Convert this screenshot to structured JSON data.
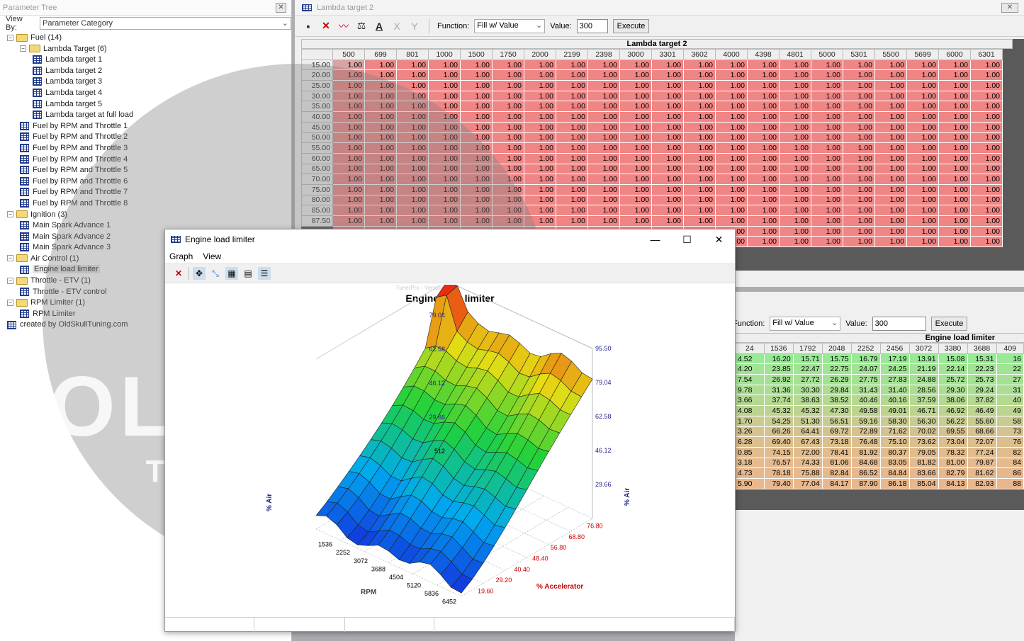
{
  "tree": {
    "title": "Parameter Tree",
    "view_by_label": "View By:",
    "view_by_value": "Parameter Category",
    "items": [
      {
        "indent": 0,
        "type": "folder",
        "label": "Fuel (14)",
        "exp": "−"
      },
      {
        "indent": 1,
        "type": "folder",
        "label": "Lambda Target (6)",
        "exp": "−"
      },
      {
        "indent": 2,
        "type": "table",
        "label": "Lambda target 1"
      },
      {
        "indent": 2,
        "type": "table",
        "label": "Lambda target 2"
      },
      {
        "indent": 2,
        "type": "table",
        "label": "Lambda target 3"
      },
      {
        "indent": 2,
        "type": "table",
        "label": "Lambda target 4"
      },
      {
        "indent": 2,
        "type": "table",
        "label": "Lambda target 5"
      },
      {
        "indent": 2,
        "type": "table",
        "label": "Lambda target at full load"
      },
      {
        "indent": 1,
        "type": "table",
        "label": "Fuel by RPM and Throttle 1"
      },
      {
        "indent": 1,
        "type": "table",
        "label": "Fuel by RPM and Throttle 2"
      },
      {
        "indent": 1,
        "type": "table",
        "label": "Fuel by RPM and Throttle 3"
      },
      {
        "indent": 1,
        "type": "table",
        "label": "Fuel by RPM and Throttle 4"
      },
      {
        "indent": 1,
        "type": "table",
        "label": "Fuel by RPM and Throttle 5"
      },
      {
        "indent": 1,
        "type": "table",
        "label": "Fuel by RPM and Throttle 6"
      },
      {
        "indent": 1,
        "type": "table",
        "label": "Fuel by RPM and Throttle 7"
      },
      {
        "indent": 1,
        "type": "table",
        "label": "Fuel by RPM and Throttle 8"
      },
      {
        "indent": 0,
        "type": "folder",
        "label": "Ignition (3)",
        "exp": "−"
      },
      {
        "indent": 1,
        "type": "table",
        "label": "Main Spark Advance 1"
      },
      {
        "indent": 1,
        "type": "table",
        "label": "Main Spark Advance 2"
      },
      {
        "indent": 1,
        "type": "table",
        "label": "Main Spark Advance 3"
      },
      {
        "indent": 0,
        "type": "folder",
        "label": "Air Control (1)",
        "exp": "−"
      },
      {
        "indent": 1,
        "type": "table",
        "label": "Engine load limiter",
        "selected": true
      },
      {
        "indent": 0,
        "type": "folder",
        "label": "Throttle - ETV (1)",
        "exp": "−"
      },
      {
        "indent": 1,
        "type": "table",
        "label": "Throttle - ETV control"
      },
      {
        "indent": 0,
        "type": "folder",
        "label": "RPM Limiter (1)",
        "exp": "−"
      },
      {
        "indent": 1,
        "type": "table",
        "label": "RPM Limiter"
      },
      {
        "indent": 0,
        "type": "table",
        "label": "created by OldSkullTuning.com"
      }
    ]
  },
  "lambda_window": {
    "title": "Lambda target 2",
    "function_label": "Function:",
    "function_value": "Fill w/ Value",
    "value_label": "Value:",
    "value": "300",
    "execute_label": "Execute",
    "table_caption": "Lambda target 2",
    "columns": [
      "500",
      "699",
      "801",
      "1000",
      "1500",
      "1750",
      "2000",
      "2199",
      "2398",
      "3000",
      "3301",
      "3602",
      "4000",
      "4398",
      "4801",
      "5000",
      "5301",
      "5500",
      "5699",
      "6000",
      "6301"
    ],
    "rows": [
      "15.00",
      "20.00",
      "25.00",
      "30.00",
      "35.00",
      "40.00",
      "45.00",
      "50.00",
      "55.00",
      "60.00",
      "65.00",
      "70.00",
      "75.00",
      "80.00",
      "85.00",
      "87.50",
      "",
      ""
    ],
    "cell_value": "1.00",
    "cell_color": "#f08585",
    "first_cell_color": "#d9a3a3"
  },
  "ell_window": {
    "function_label": "Function:",
    "function_value": "Fill w/ Value",
    "value_label": "Value:",
    "value": "300",
    "execute_label": "Execute",
    "table_caption": "Engine load limiter",
    "columns": [
      "24",
      "1536",
      "1792",
      "2048",
      "2252",
      "2456",
      "3072",
      "3380",
      "3688",
      "409"
    ],
    "rows": [
      [
        "4.52",
        "16.20",
        "15.71",
        "15.75",
        "16.79",
        "17.19",
        "13.91",
        "15.08",
        "15.31",
        "16"
      ],
      [
        "4.20",
        "23.85",
        "22.47",
        "22.75",
        "24.07",
        "24.25",
        "21.19",
        "22.14",
        "22.23",
        "22"
      ],
      [
        "7.54",
        "26.92",
        "27.72",
        "26.29",
        "27.75",
        "27.83",
        "24.88",
        "25.72",
        "25.73",
        "27"
      ],
      [
        "9.78",
        "31.36",
        "30.30",
        "29.84",
        "31.43",
        "31.40",
        "28.56",
        "29.30",
        "29.24",
        "31"
      ],
      [
        "3.66",
        "37.74",
        "38.63",
        "38.52",
        "40.46",
        "40.16",
        "37.59",
        "38.06",
        "37.82",
        "40"
      ],
      [
        "4.08",
        "45.32",
        "45.32",
        "47.30",
        "49.58",
        "49.01",
        "46.71",
        "46.92",
        "46.49",
        "49"
      ],
      [
        "1.70",
        "54.25",
        "51.30",
        "56.51",
        "59.16",
        "58.30",
        "56.30",
        "56.22",
        "55.60",
        "58"
      ],
      [
        "3.26",
        "66.26",
        "64.41",
        "69.72",
        "72.89",
        "71.62",
        "70.02",
        "69.55",
        "68.66",
        "73"
      ],
      [
        "6.28",
        "69.40",
        "67.43",
        "73.18",
        "76.48",
        "75.10",
        "73.62",
        "73.04",
        "72.07",
        "76"
      ],
      [
        "0.85",
        "74.15",
        "72.00",
        "78.41",
        "81.92",
        "80.37",
        "79.05",
        "78.32",
        "77.24",
        "82"
      ],
      [
        "3.18",
        "76.57",
        "74.33",
        "81.06",
        "84.68",
        "83.05",
        "81.82",
        "81.00",
        "79.87",
        "84"
      ],
      [
        "4.73",
        "78.18",
        "75.88",
        "82.84",
        "86.52",
        "84.84",
        "83.66",
        "82.79",
        "81.62",
        "86"
      ],
      [
        "5.90",
        "79.40",
        "77.04",
        "84.17",
        "87.90",
        "86.18",
        "85.04",
        "84.13",
        "82.93",
        "88"
      ]
    ]
  },
  "graph_window": {
    "title": "Engine load limiter",
    "menu": [
      "Graph",
      "View"
    ],
    "version_text": "TunerPro - Version 5.00",
    "chart_title": "Engine load limiter",
    "z_label": "% Air",
    "x_label": "RPM",
    "y_label": "% Accelerator",
    "z_ticks": [
      "95.50",
      "79.04",
      "62.58",
      "46.12",
      "29.66",
      "512"
    ],
    "z_ticks_right": [
      "95.50",
      "79.04",
      "62.58",
      "46.12",
      "29.66"
    ],
    "x_ticks": [
      "1536",
      "2252",
      "3072",
      "3688",
      "4504",
      "5120",
      "5836",
      "6452"
    ],
    "y_ticks": [
      "76.80",
      "68.80",
      "56.80",
      "48.40",
      "40.40",
      "29.20",
      "19.60"
    ],
    "watermark_top": "OLDSKULL",
    "watermark_bottom": "TUNING"
  },
  "colors": {
    "lambda_cell": "#f08585",
    "accent": "#223b8c"
  }
}
